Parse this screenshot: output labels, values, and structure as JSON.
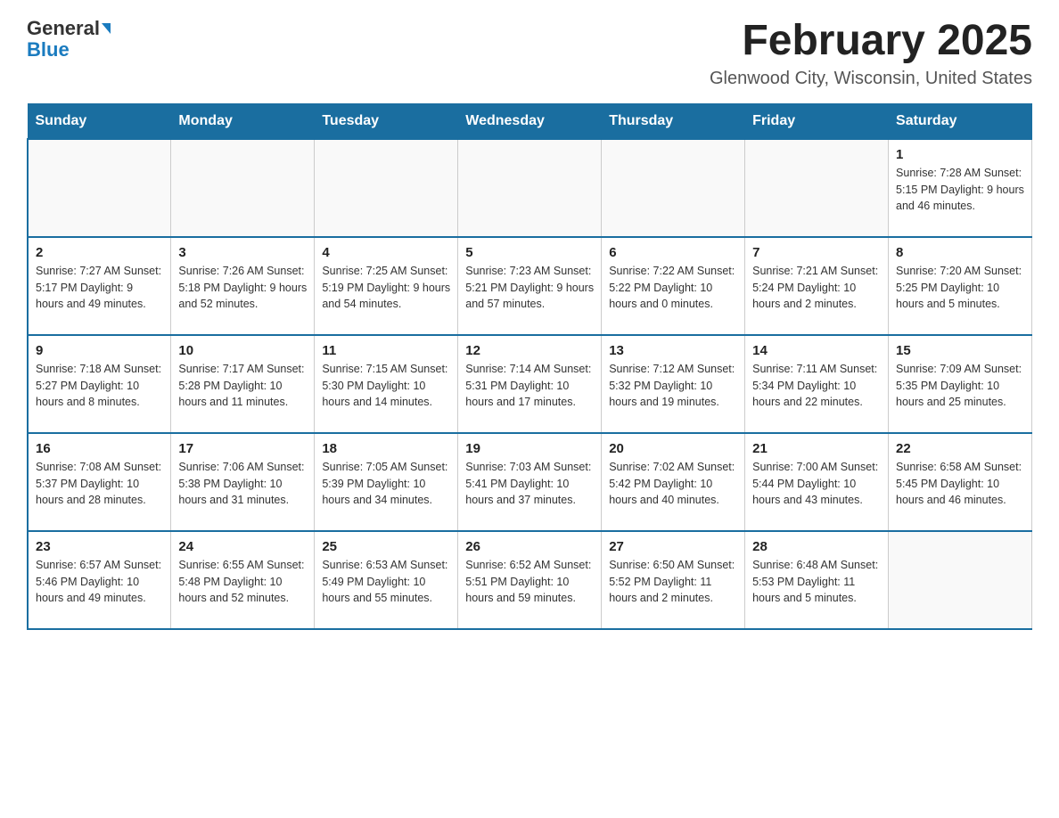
{
  "header": {
    "logo_general": "General",
    "logo_blue": "Blue",
    "month_title": "February 2025",
    "location": "Glenwood City, Wisconsin, United States"
  },
  "days_of_week": [
    "Sunday",
    "Monday",
    "Tuesday",
    "Wednesday",
    "Thursday",
    "Friday",
    "Saturday"
  ],
  "weeks": [
    [
      {
        "day": "",
        "info": ""
      },
      {
        "day": "",
        "info": ""
      },
      {
        "day": "",
        "info": ""
      },
      {
        "day": "",
        "info": ""
      },
      {
        "day": "",
        "info": ""
      },
      {
        "day": "",
        "info": ""
      },
      {
        "day": "1",
        "info": "Sunrise: 7:28 AM\nSunset: 5:15 PM\nDaylight: 9 hours\nand 46 minutes."
      }
    ],
    [
      {
        "day": "2",
        "info": "Sunrise: 7:27 AM\nSunset: 5:17 PM\nDaylight: 9 hours\nand 49 minutes."
      },
      {
        "day": "3",
        "info": "Sunrise: 7:26 AM\nSunset: 5:18 PM\nDaylight: 9 hours\nand 52 minutes."
      },
      {
        "day": "4",
        "info": "Sunrise: 7:25 AM\nSunset: 5:19 PM\nDaylight: 9 hours\nand 54 minutes."
      },
      {
        "day": "5",
        "info": "Sunrise: 7:23 AM\nSunset: 5:21 PM\nDaylight: 9 hours\nand 57 minutes."
      },
      {
        "day": "6",
        "info": "Sunrise: 7:22 AM\nSunset: 5:22 PM\nDaylight: 10 hours\nand 0 minutes."
      },
      {
        "day": "7",
        "info": "Sunrise: 7:21 AM\nSunset: 5:24 PM\nDaylight: 10 hours\nand 2 minutes."
      },
      {
        "day": "8",
        "info": "Sunrise: 7:20 AM\nSunset: 5:25 PM\nDaylight: 10 hours\nand 5 minutes."
      }
    ],
    [
      {
        "day": "9",
        "info": "Sunrise: 7:18 AM\nSunset: 5:27 PM\nDaylight: 10 hours\nand 8 minutes."
      },
      {
        "day": "10",
        "info": "Sunrise: 7:17 AM\nSunset: 5:28 PM\nDaylight: 10 hours\nand 11 minutes."
      },
      {
        "day": "11",
        "info": "Sunrise: 7:15 AM\nSunset: 5:30 PM\nDaylight: 10 hours\nand 14 minutes."
      },
      {
        "day": "12",
        "info": "Sunrise: 7:14 AM\nSunset: 5:31 PM\nDaylight: 10 hours\nand 17 minutes."
      },
      {
        "day": "13",
        "info": "Sunrise: 7:12 AM\nSunset: 5:32 PM\nDaylight: 10 hours\nand 19 minutes."
      },
      {
        "day": "14",
        "info": "Sunrise: 7:11 AM\nSunset: 5:34 PM\nDaylight: 10 hours\nand 22 minutes."
      },
      {
        "day": "15",
        "info": "Sunrise: 7:09 AM\nSunset: 5:35 PM\nDaylight: 10 hours\nand 25 minutes."
      }
    ],
    [
      {
        "day": "16",
        "info": "Sunrise: 7:08 AM\nSunset: 5:37 PM\nDaylight: 10 hours\nand 28 minutes."
      },
      {
        "day": "17",
        "info": "Sunrise: 7:06 AM\nSunset: 5:38 PM\nDaylight: 10 hours\nand 31 minutes."
      },
      {
        "day": "18",
        "info": "Sunrise: 7:05 AM\nSunset: 5:39 PM\nDaylight: 10 hours\nand 34 minutes."
      },
      {
        "day": "19",
        "info": "Sunrise: 7:03 AM\nSunset: 5:41 PM\nDaylight: 10 hours\nand 37 minutes."
      },
      {
        "day": "20",
        "info": "Sunrise: 7:02 AM\nSunset: 5:42 PM\nDaylight: 10 hours\nand 40 minutes."
      },
      {
        "day": "21",
        "info": "Sunrise: 7:00 AM\nSunset: 5:44 PM\nDaylight: 10 hours\nand 43 minutes."
      },
      {
        "day": "22",
        "info": "Sunrise: 6:58 AM\nSunset: 5:45 PM\nDaylight: 10 hours\nand 46 minutes."
      }
    ],
    [
      {
        "day": "23",
        "info": "Sunrise: 6:57 AM\nSunset: 5:46 PM\nDaylight: 10 hours\nand 49 minutes."
      },
      {
        "day": "24",
        "info": "Sunrise: 6:55 AM\nSunset: 5:48 PM\nDaylight: 10 hours\nand 52 minutes."
      },
      {
        "day": "25",
        "info": "Sunrise: 6:53 AM\nSunset: 5:49 PM\nDaylight: 10 hours\nand 55 minutes."
      },
      {
        "day": "26",
        "info": "Sunrise: 6:52 AM\nSunset: 5:51 PM\nDaylight: 10 hours\nand 59 minutes."
      },
      {
        "day": "27",
        "info": "Sunrise: 6:50 AM\nSunset: 5:52 PM\nDaylight: 11 hours\nand 2 minutes."
      },
      {
        "day": "28",
        "info": "Sunrise: 6:48 AM\nSunset: 5:53 PM\nDaylight: 11 hours\nand 5 minutes."
      },
      {
        "day": "",
        "info": ""
      }
    ]
  ]
}
